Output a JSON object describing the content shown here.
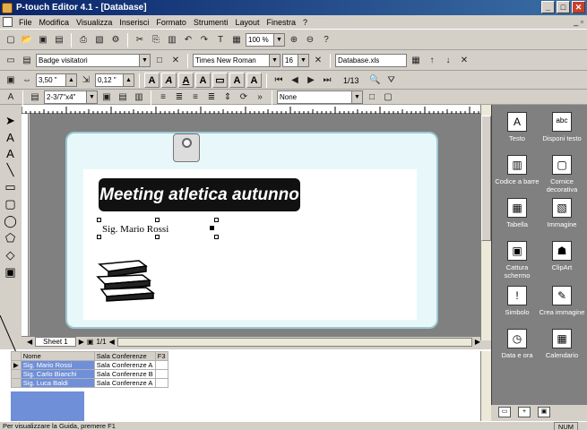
{
  "window": {
    "title": "P-touch Editor 4.1 - [Database]"
  },
  "menu": [
    "File",
    "Modifica",
    "Visualizza",
    "Inserisci",
    "Formato",
    "Strumenti",
    "Layout",
    "Finestra",
    "?"
  ],
  "toolbar1": {
    "zoom": "100 %"
  },
  "toolbar2": {
    "template": "Badge visitatori",
    "width": "3,50 \"",
    "margin": "0,12 \"",
    "font": "Times New Roman",
    "size": "16",
    "database": "Database.xls",
    "record": "1/13"
  },
  "toolbar3": {
    "tape": "2-3/7\"x4\"",
    "none_option": "None"
  },
  "label": {
    "heading": "Meeting atletica autunno",
    "name_field": "Sig. Mario Rossi"
  },
  "sheetbar": {
    "sheet": "Sheet 1",
    "pages": "1/1"
  },
  "database": {
    "headers": [
      "Nome",
      "Sala Conferenze",
      "F3"
    ],
    "rows": [
      [
        "Sig. Mario Rossi",
        "Sala Conferenze A",
        ""
      ],
      [
        "Sig. Carlo Bianchi",
        "Sala Conferenze B",
        ""
      ],
      [
        "Sig. Luca Baldi",
        "Sala Conferenze A",
        ""
      ]
    ]
  },
  "tools": [
    {
      "label": "Testo",
      "icon": "text-tool-icon"
    },
    {
      "label": "Disponi testo",
      "icon": "arrange-text-icon"
    },
    {
      "label": "Codice a barre",
      "icon": "barcode-icon"
    },
    {
      "label": "Cornice decorativa",
      "icon": "frame-icon"
    },
    {
      "label": "Tabella",
      "icon": "table-icon"
    },
    {
      "label": "Immagine",
      "icon": "image-icon"
    },
    {
      "label": "Cattura schermo",
      "icon": "screen-capture-icon"
    },
    {
      "label": "ClipArt",
      "icon": "clipart-icon"
    },
    {
      "label": "Simbolo",
      "icon": "symbol-icon"
    },
    {
      "label": "Crea immagine",
      "icon": "make-image-icon"
    },
    {
      "label": "Data e ora",
      "icon": "date-time-icon"
    },
    {
      "label": "Calendario",
      "icon": "calendar-icon"
    }
  ],
  "status": {
    "help": "Per visualizzare la Guida, premere F1",
    "num": "NUM"
  }
}
